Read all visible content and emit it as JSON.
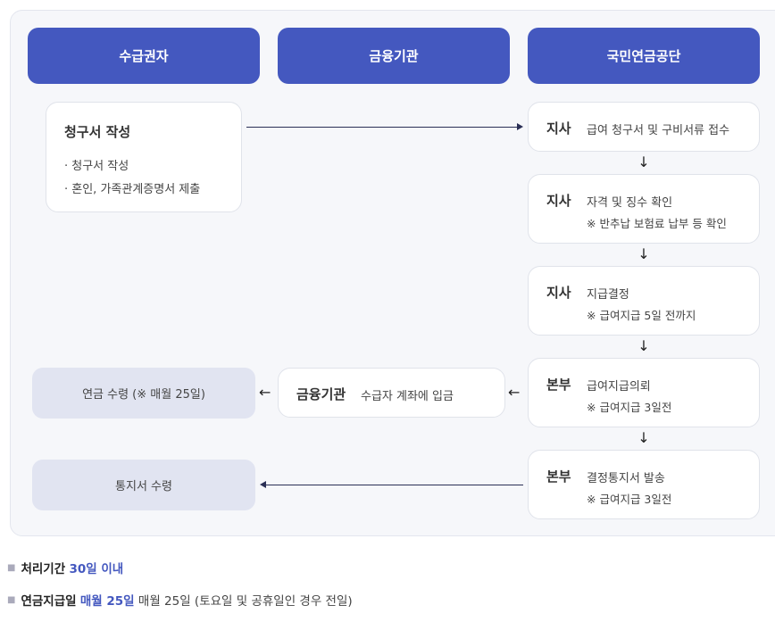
{
  "headers": {
    "recipient": "수급권자",
    "bank": "금융기관",
    "nps": "국민연금공단"
  },
  "claim_card": {
    "title": "청구서 작성",
    "items": [
      "· 청구서 작성",
      "· 혼인, 가족관계증명서 제출"
    ]
  },
  "steps": [
    {
      "who": "지사",
      "desc": "급여 청구서 및 구비서류 접수",
      "note": ""
    },
    {
      "who": "지사",
      "desc": "자격 및 징수 확인",
      "note": "※ 반추납 보험료 납부 등 확인"
    },
    {
      "who": "지사",
      "desc": "지급결정",
      "note": "※ 급여지급 5일 전까지"
    },
    {
      "who": "본부",
      "desc": "급여지급의뢰",
      "note": "※ 급여지급 3일전"
    },
    {
      "who": "본부",
      "desc": "결정통지서 발송",
      "note": "※ 급여지급 3일전"
    }
  ],
  "bank_card": {
    "who": "금융기관",
    "desc": "수급자 계좌에 입금"
  },
  "results": {
    "pension": "연금 수령 (※ 매월 25일)",
    "notice": "통지서 수령"
  },
  "arrows": {
    "down": "↓",
    "left": "←"
  },
  "info": {
    "period_label": "처리기간",
    "period_value": "30일 이내",
    "payday_label": "연금지급일",
    "payday_value": "매월 25일",
    "payday_note": "매월 25일 (토요일 및 공휴일인 경우 전일)"
  },
  "colors": {
    "accent": "#4458bf",
    "result_bg": "#e1e4f1",
    "panel_bg": "#f6f7fa"
  }
}
